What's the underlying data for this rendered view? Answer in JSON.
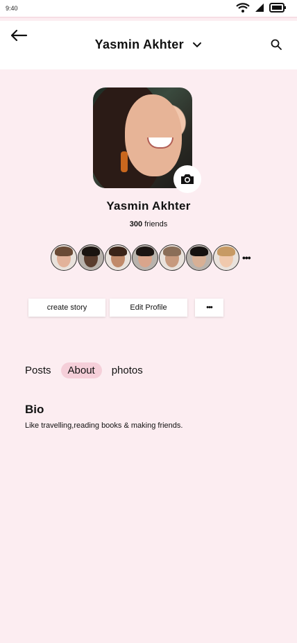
{
  "status_bar": {
    "time": "9:40"
  },
  "header": {
    "title": "Yasmin Akhter"
  },
  "profile": {
    "name": "Yasmin Akhter",
    "friends_count": "300",
    "friends_label": "friends"
  },
  "friends": [
    {
      "skin": "#e2b29a",
      "hair": "#6a4a35"
    },
    {
      "skin": "#5a3d2e",
      "hair": "#1a1410"
    },
    {
      "skin": "#c08a6a",
      "hair": "#3b2418"
    },
    {
      "skin": "#d9a58c",
      "hair": "#1b1412"
    },
    {
      "skin": "#c79a7e",
      "hair": "#8a6e58"
    },
    {
      "skin": "#d8b095",
      "hair": "#15110f"
    },
    {
      "skin": "#f0c9ad",
      "hair": "#c79a64"
    }
  ],
  "friends_more": "•••",
  "actions": {
    "create_story": "create story",
    "edit_profile": "Edit Profile",
    "more": "•••"
  },
  "tabs": [
    "Posts",
    "About",
    "photos"
  ],
  "active_tab": "About",
  "bio": {
    "heading": "Bio",
    "text": "Like travelling,reading books & making friends."
  },
  "colors": {
    "background": "#fcedf1",
    "active_tab_bg": "#f5cfd9"
  }
}
